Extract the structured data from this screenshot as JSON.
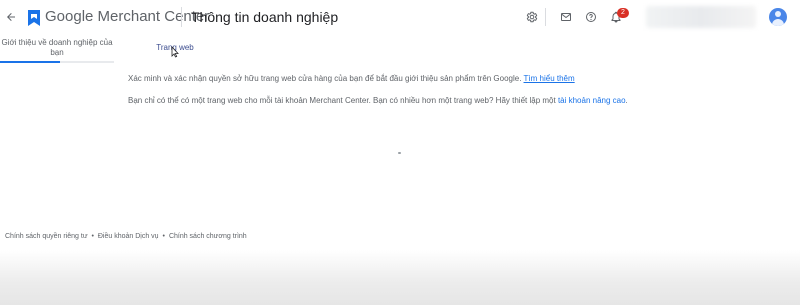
{
  "header": {
    "back_icon": "arrow-back-icon",
    "logo_icon": "merchant-center-logo",
    "app_name": "Google Merchant Center",
    "page_title": "Thông tin doanh nghiệp",
    "icons": [
      "settings-icon",
      "mail-icon",
      "help-icon",
      "notifications-icon"
    ],
    "notification_count": "2",
    "brand_colors": {
      "blue": "#1a73e8",
      "badge": "#d93025"
    }
  },
  "tabs": [
    {
      "label": "Giới thiệu về doanh nghiệp của bạn",
      "active": true
    },
    {
      "label": "Trang web",
      "active": false
    }
  ],
  "content": {
    "line1_text": "Xác minh và xác nhận quyền sở hữu trang web cửa hàng của bạn để bắt đầu giới thiệu sản phẩm trên Google.",
    "line1_link": "Tìm hiểu thêm",
    "line2_text": "Bạn chỉ có thể có một trang web cho mỗi tài khoản Merchant Center. Bạn có nhiều hơn một trang web? Hãy thiết lập một",
    "line2_link": "tài khoản nâng cao",
    "line2_end": "."
  },
  "footer": {
    "privacy": "Chính sách quyền riêng tư",
    "terms": "Điều khoản Dịch vụ",
    "program": "Chính sách chương trình",
    "separator": "•"
  }
}
